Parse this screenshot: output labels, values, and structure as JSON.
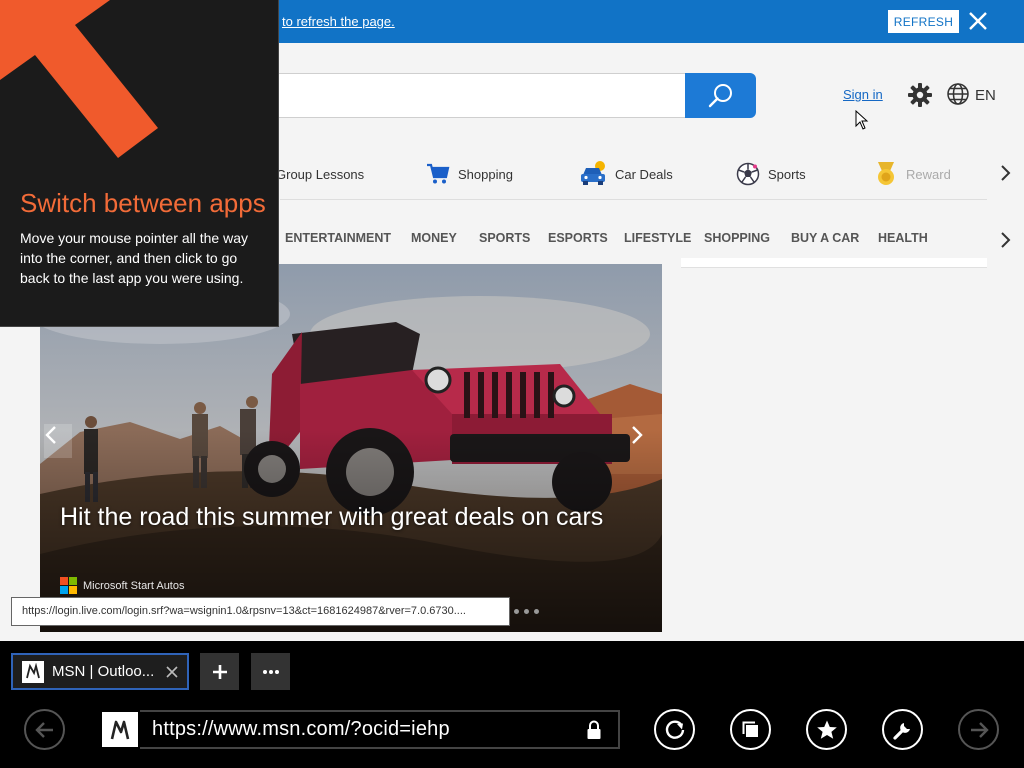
{
  "notification": {
    "text": "to refresh the page.",
    "refresh_label": "REFRESH"
  },
  "header": {
    "sign_in": "Sign in",
    "language": "EN"
  },
  "quick_links": [
    {
      "label": "Group Lessons",
      "icon": "group-lessons-icon"
    },
    {
      "label": "Shopping",
      "icon": "shopping-cart-icon"
    },
    {
      "label": "Car Deals",
      "icon": "car-icon"
    },
    {
      "label": "Sports",
      "icon": "soccer-ball-icon"
    },
    {
      "label": "Rewards",
      "icon": "medal-icon"
    }
  ],
  "categories": [
    "ENTERTAINMENT",
    "MONEY",
    "SPORTS",
    "ESPORTS",
    "LIFESTYLE",
    "SHOPPING",
    "BUY A CAR",
    "HEALTH"
  ],
  "hero": {
    "title": "Hit the road this summer with great deals on cars",
    "source": "Microsoft Start Autos"
  },
  "status_url": "https://login.live.com/login.srf?wa=wsignin1.0&rpsnv=13&ct=1681624987&rver=7.0.6730....",
  "switch_overlay": {
    "title": "Switch between apps",
    "body": "Move your mouse pointer all the way into the corner, and then click to go back to the last app you were using."
  },
  "browser": {
    "tab_title": "MSN | Outloo...",
    "address": "https://www.msn.com/?ocid=iehp"
  },
  "colors": {
    "notification_bg": "#1173c6",
    "accent_orange": "#f26b38",
    "search_button": "#1d7ad6"
  }
}
